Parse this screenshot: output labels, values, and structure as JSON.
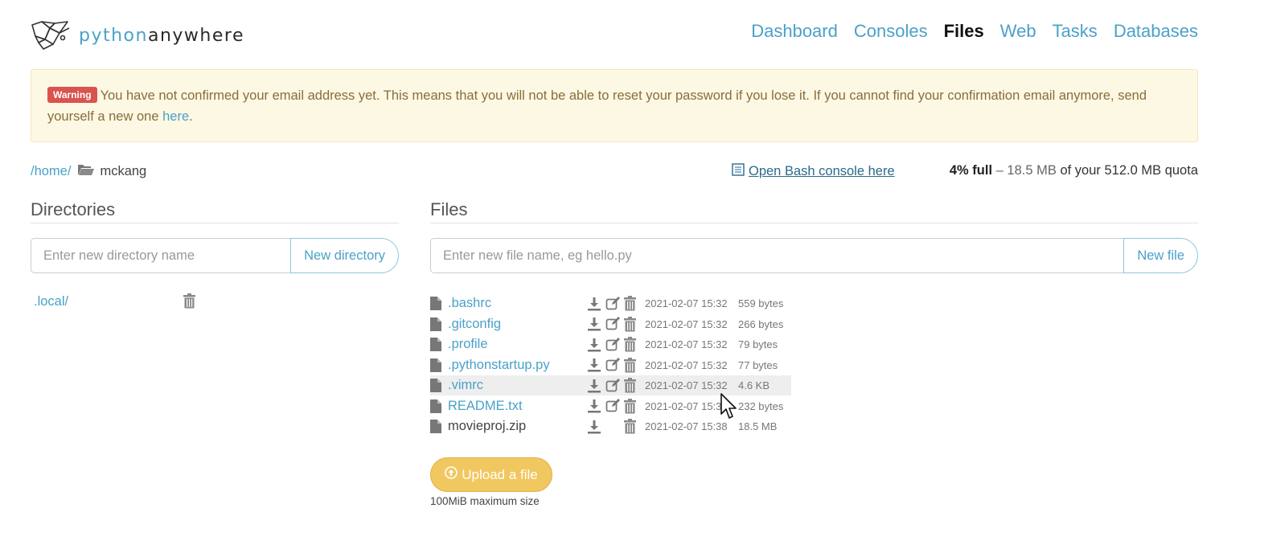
{
  "header": {
    "logo_part1": "python",
    "logo_part2": "anywhere",
    "nav": [
      "Dashboard",
      "Consoles",
      "Files",
      "Web",
      "Tasks",
      "Databases"
    ],
    "active_nav": "Files"
  },
  "warning": {
    "badge": "Warning",
    "text": "You have not confirmed your email address yet. This means that you will not be able to reset your password if you lose it. If you cannot find your confirmation email anymore, send yourself a new one ",
    "link": "here",
    "trailing": "."
  },
  "path": {
    "home": "/home/",
    "current": "mckang"
  },
  "bash_link": "Open Bash console here",
  "quota": {
    "percent": "4% full",
    "dash": " – ",
    "used": "18.5 MB",
    "of_text": " of your ",
    "total": "512.0 MB",
    "suffix": " quota"
  },
  "directories": {
    "title": "Directories",
    "placeholder": "Enter new directory name",
    "button": "New directory",
    "items": [
      ".local/"
    ]
  },
  "files": {
    "title": "Files",
    "placeholder": "Enter new file name, eg hello.py",
    "button": "New file",
    "items": [
      {
        "name": ".bashrc",
        "date": "2021-02-07 15:32",
        "size": "559 bytes"
      },
      {
        "name": ".gitconfig",
        "date": "2021-02-07 15:32",
        "size": "266 bytes"
      },
      {
        "name": ".profile",
        "date": "2021-02-07 15:32",
        "size": "79 bytes"
      },
      {
        "name": ".pythonstartup.py",
        "date": "2021-02-07 15:32",
        "size": "77 bytes"
      },
      {
        "name": ".vimrc",
        "date": "2021-02-07 15:32",
        "size": "4.6 KB"
      },
      {
        "name": "README.txt",
        "date": "2021-02-07 15:3",
        "size": "232 bytes"
      },
      {
        "name": "movieproj.zip",
        "date": "2021-02-07 15:38",
        "size": "18.5 MB"
      }
    ]
  },
  "upload": {
    "button": "Upload a file",
    "max_size": "100MiB maximum size"
  },
  "colors": {
    "link": "#4aa1c9",
    "warning_bg": "#fcf8e3",
    "badge": "#d9534f",
    "upload": "#f1c75f"
  }
}
